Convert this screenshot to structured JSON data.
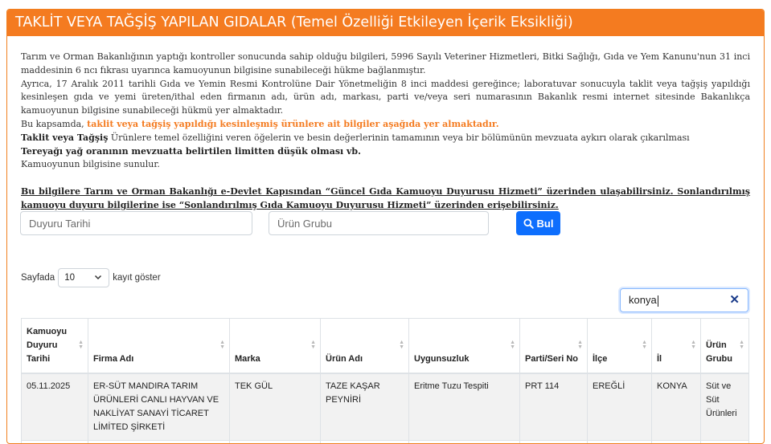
{
  "header": {
    "title": "TAKLİT VEYA TAĞŞİŞ YAPILAN GIDALAR (Temel Özelliği Etkileyen İçerik Eksikliği)"
  },
  "info": {
    "p1": "Tarım ve Orman Bakanlığının yaptığı kontroller sonucunda sahip olduğu bilgileri, 5996 Sayılı Veteriner Hizmetleri, Bitki Sağlığı, Gıda ve Yem Kanunu'nun 31 inci maddesinin 6 ncı fıkrası uyarınca kamuoyunun bilgisine sunabileceği hükme bağlanmıştır.",
    "p2": "Ayrıca, 17 Aralık 2011 tarihli Gıda ve Yemin Resmi Kontrolüne Dair Yönetmeliğin 8 inci maddesi gereğince; laboratuvar sonucuyla taklit veya tağşiş yapıldığı kesinleşen gıda ve yemi üreten/ithal eden firmanın adı, ürün adı, markası, parti ve/veya seri numarasının Bakanlık resmi internet sitesinde Bakanlıkça kamuoyunun bilgisine sunabileceği hükmü yer almaktadır.",
    "p3_prefix": "Bu kapsamda, ",
    "p3_highlight": "taklit veya tağşiş yapıldığı kesinleşmiş ürünlere ait bilgiler aşağıda yer almaktadır.",
    "p4_bold": "Taklit veya Tağşiş",
    "p4_rest": " Ürünlere temel özelliğini veren öğelerin ve besin değerlerinin tamamının veya bir bölümünün mevzuata aykırı olarak çıkarılması",
    "p5": "Tereyağı yağ oranının mevzuatta belirtilen limitten düşük olması vb.",
    "p6": "Kamuoyunun bilgisine sunulur.",
    "notice": "Bu bilgilere Tarım ve Orman Bakanlığı e-Devlet Kapısından “Güncel Gıda Kamuoyu Duyurusu Hizmeti” üzerinden ulaşabilirsiniz. Sonlandırılmış kamuoyu duyuru bilgilerine ise “Sonlandırılmış Gıda Kamuoyu Duyurusu Hizmeti” üzerinden erişebilirsiniz."
  },
  "filters": {
    "date_placeholder": "Duyuru Tarihi",
    "group_placeholder": "Ürün Grubu",
    "search_button": "Bul"
  },
  "length": {
    "prefix": "Sayfada",
    "value": "10",
    "suffix": "kayıt göster"
  },
  "search": {
    "value": "konya"
  },
  "table": {
    "headers": [
      "Kamuoyu Duyuru Tarihi",
      "Firma Adı",
      "Marka",
      "Ürün Adı",
      "Uygunsuzluk",
      "Parti/Seri No",
      "İlçe",
      "İl",
      "Ürün Grubu"
    ],
    "rows": [
      [
        "05.11.2025",
        "ER-SÜT MANDIRA TARIM ÜRÜNLERİ CANLI HAYVAN VE NAKLİYAT SANAYİ TİCARET LİMİTED ŞİRKETİ",
        "TEK GÜL",
        "TAZE KAŞAR PEYNİRİ",
        "Eritme Tuzu Tespiti",
        "PRT 114",
        "EREĞLİ",
        "KONYA",
        "Süt ve Süt Ürünleri"
      ]
    ]
  },
  "colors": {
    "header": "#f47b20",
    "accent": "#f47b20",
    "button": "#0d6efd"
  }
}
